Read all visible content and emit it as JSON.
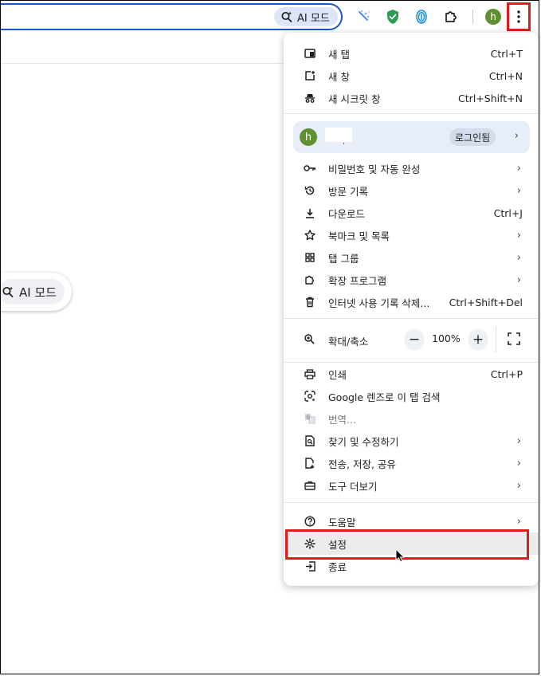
{
  "toolbar": {
    "ai_mode_label": "AI 모드",
    "avatar_letter": "h"
  },
  "page": {
    "ai_mode_label": "AI 모드"
  },
  "menu": {
    "new_tab": {
      "label": "새 탭",
      "shortcut": "Ctrl+T"
    },
    "new_window": {
      "label": "새 창",
      "shortcut": "Ctrl+N"
    },
    "incognito": {
      "label": "새 시크릿 창",
      "shortcut": "Ctrl+Shift+N"
    },
    "profile": {
      "avatar_letter": "h",
      "name_fragment": ",",
      "login_label": "로그인됨"
    },
    "passwords": {
      "label": "비밀번호 및 자동 완성"
    },
    "history": {
      "label": "방문 기록"
    },
    "downloads": {
      "label": "다운로드",
      "shortcut": "Ctrl+J"
    },
    "bookmarks": {
      "label": "북마크 및 목록"
    },
    "tab_groups": {
      "label": "탭 그룹"
    },
    "extensions": {
      "label": "확장 프로그램"
    },
    "clear_data": {
      "label": "인터넷 사용 기록 삭제...",
      "shortcut": "Ctrl+Shift+Del"
    },
    "zoom": {
      "label": "확대/축소",
      "minus": "−",
      "value": "100%",
      "plus": "+"
    },
    "print": {
      "label": "인쇄",
      "shortcut": "Ctrl+P"
    },
    "lens": {
      "label": "Google 렌즈로 이 탭 검색"
    },
    "translate": {
      "label": "번역..."
    },
    "find_edit": {
      "label": "찾기 및 수정하기"
    },
    "cast_save_share": {
      "label": "전송, 저장, 공유"
    },
    "more_tools": {
      "label": "도구 더보기"
    },
    "help": {
      "label": "도움말"
    },
    "settings": {
      "label": "설정"
    },
    "exit": {
      "label": "종료"
    }
  },
  "colors": {
    "highlight_red": "#e11b1b",
    "omnibox_border": "#1a56c5",
    "avatar_green": "#5f9131",
    "profile_bg": "#e8eef8"
  },
  "icons": [
    "ai-sparkle-search-icon",
    "ai-extension-icon",
    "shield-icon",
    "fingerprint-icon",
    "puzzle-icon",
    "kebab-icon",
    "new-tab-icon",
    "new-window-icon",
    "incognito-icon",
    "key-icon",
    "history-icon",
    "download-icon",
    "star-icon",
    "grid-icon",
    "extension-icon",
    "trash-icon",
    "zoom-icon",
    "fullscreen-icon",
    "print-icon",
    "lens-icon",
    "translate-icon",
    "find-icon",
    "share-icon",
    "toolbox-icon",
    "help-icon",
    "gear-icon",
    "exit-icon",
    "chevron-right-icon"
  ]
}
